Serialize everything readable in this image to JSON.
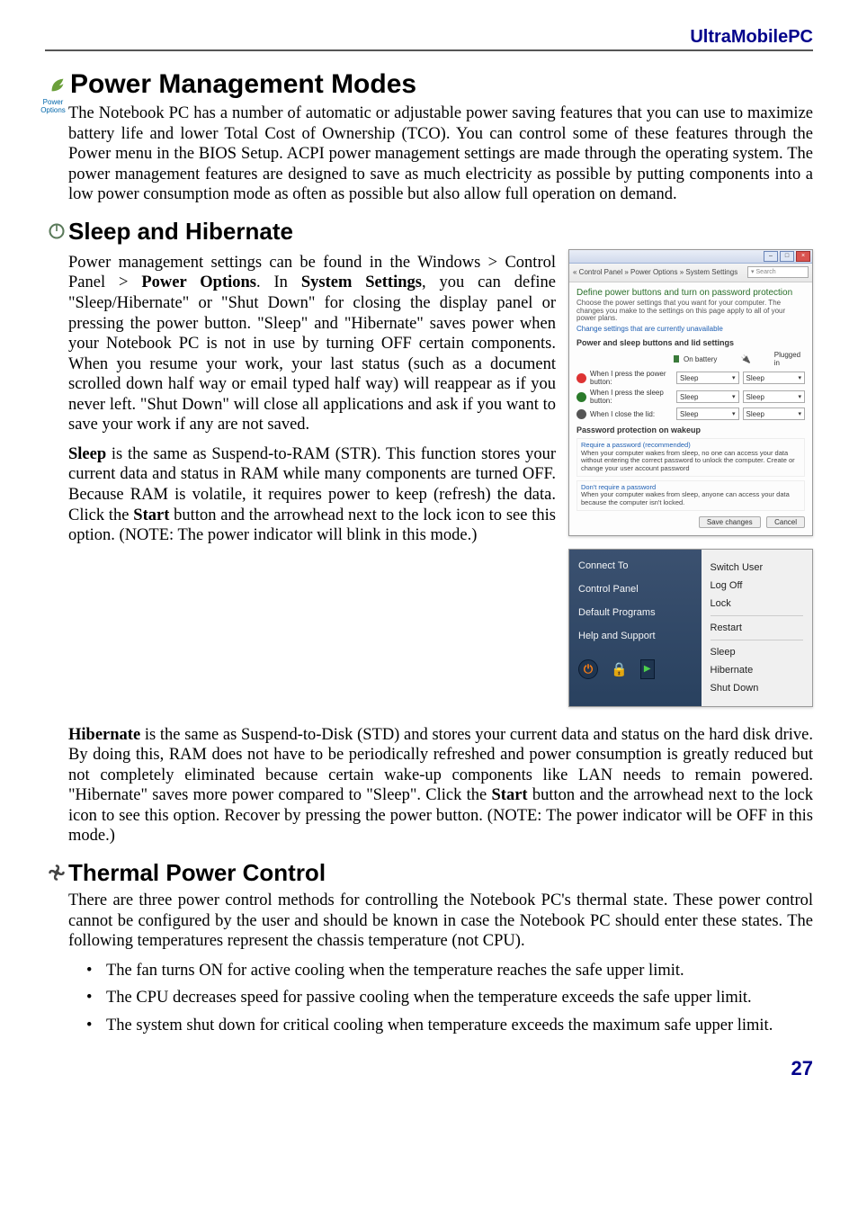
{
  "header": {
    "brand": "UltraMobilePC"
  },
  "iconLabel": "Power Options",
  "section1": {
    "title": "Power Management Modes",
    "body": "The Notebook PC has a number of automatic or adjustable power saving features that you can use to maximize battery life and lower Total Cost of Ownership (TCO). You can control some of these features through the Power menu in the BIOS Setup. ACPI power management settings are made through the operating system. The power management features are designed to save as much electricity as possible by putting components into a low power consumption mode as often as possible but also allow full operation on demand."
  },
  "section2": {
    "title": "Sleep and Hibernate",
    "p1a": "Power management settings can be found in the Windows > Control Panel > ",
    "p1b": "Power Options",
    "p1c": ". In ",
    "p1d": "System Settings",
    "p1e": ", you can define \"Sleep/Hibernate\" or \"Shut Down\" for closing the display panel or pressing the power button. \"Sleep\" and \"Hibernate\" saves power when your Notebook PC is not in use by turning OFF certain components. When you resume your work, your last status (such as a document scrolled down half way or email typed half way) will reappear as if you never left. \"Shut Down\" will close all applications and ask if you want to save your work if any are not saved.",
    "p2a": "Sleep",
    "p2b": " is the same as Suspend-to-RAM (STR). This function stores your current data and status in RAM while many components are turned OFF. Because RAM is volatile, it requires power to keep (refresh) the data. Click the ",
    "p2c": "Start",
    "p2d": " button and the arrowhead next to the lock icon to see this option. (NOTE: The power indicator will blink in this mode.)",
    "p3a": "Hibernate",
    "p3b": " is the same as  Suspend-to-Disk (STD) and stores your current data and status on the hard disk drive. By doing this, RAM does not have to be periodically refreshed and power consumption is greatly reduced but not completely eliminated because certain wake-up components like LAN needs to remain powered. \"Hibernate\" saves more power compared to \"Sleep\". Click the ",
    "p3c": "Start",
    "p3d": " button and the arrowhead next to the lock icon to see this option. Recover by pressing the power button. (NOTE: The power indicator will be OFF in this mode.)"
  },
  "section3": {
    "title": "Thermal Power Control",
    "intro": "There are three power control methods for controlling the Notebook PC's thermal state. These power control cannot be configured by the user and should be known in case the Notebook PC should enter these states. The following temperatures represent the chassis temperature (not CPU).",
    "bullets": [
      "The fan turns ON for active cooling when the temperature reaches the safe upper limit.",
      "The CPU decreases speed for passive cooling when the temperature exceeds the safe upper limit.",
      "The system shut down for critical cooling when temperature exceeds the maximum safe upper limit."
    ]
  },
  "shot1": {
    "breadcrumb": "« Control Panel » Power Options » System Settings",
    "searchPlaceholder": "Search",
    "title": "Define power buttons and turn on password protection",
    "desc": "Choose the power settings that you want for your computer. The changes you make to the settings on this page apply to all of your power plans.",
    "changeLink": "Change settings that are currently unavailable",
    "groupLabel": "Power and sleep buttons and lid settings",
    "colBattery": "On battery",
    "colPlugged": "Plugged in",
    "rows": [
      {
        "label": "When I press the power button:",
        "val": "Sleep"
      },
      {
        "label": "When I press the sleep button:",
        "val": "Sleep"
      },
      {
        "label": "When I close the lid:",
        "val": "Sleep"
      }
    ],
    "protHeader": "Password protection on wakeup",
    "opt1t": "Require a password (recommended)",
    "opt1d": "When your computer wakes from sleep, no one can access your data without entering the correct password to unlock the computer. Create or change your user account password",
    "opt2t": "Don't require a password",
    "opt2d": "When your computer wakes from sleep, anyone can access your data because the computer isn't locked.",
    "save": "Save changes",
    "cancel": "Cancel"
  },
  "shot2": {
    "left": [
      "Connect To",
      "Control Panel",
      "Default Programs",
      "Help and Support"
    ],
    "right": [
      "Switch User",
      "Log Off",
      "Lock",
      "Restart",
      "Sleep",
      "Hibernate",
      "Shut Down"
    ]
  },
  "pagenum": "27"
}
